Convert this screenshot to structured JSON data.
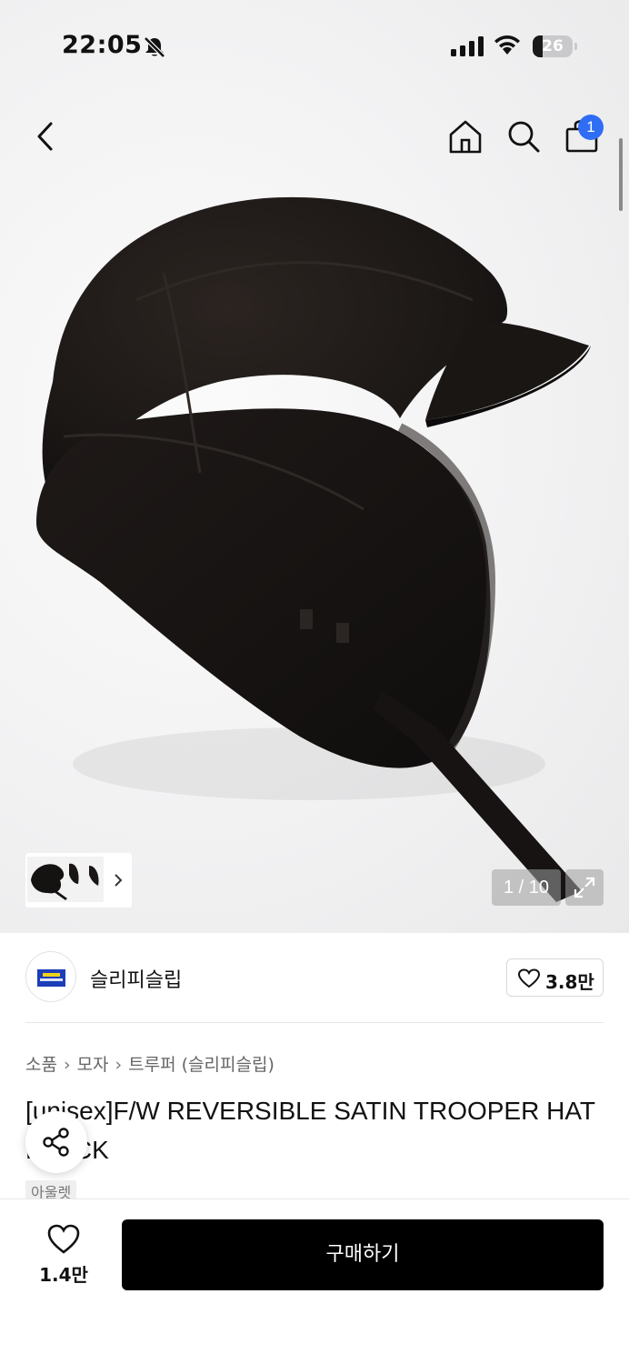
{
  "status_bar": {
    "time": "22:05",
    "battery_percent": "26",
    "battery_level": 0.26,
    "icons": [
      "bell-slash-icon",
      "cellular-signal-icon",
      "wifi-icon",
      "battery-icon"
    ]
  },
  "nav": {
    "icons": [
      "back-chevron-icon",
      "home-icon",
      "search-icon",
      "shopping-bag-icon"
    ],
    "cart_badge": "1"
  },
  "gallery": {
    "counter": "1 / 10",
    "current_index": 1,
    "total": 10,
    "icons": [
      "chevron-right-icon",
      "expand-icon"
    ]
  },
  "brand": {
    "name": "슬리피슬립",
    "like_count": "3.8만",
    "icons": [
      "heart-outline-icon"
    ]
  },
  "breadcrumb": [
    "소품",
    "모자",
    "트루퍼 (슬리피슬립)"
  ],
  "product": {
    "title": "[unisex]F/W REVERSIBLE SATIN TROOPER HAT BLACK",
    "tag": "아울렛"
  },
  "bottom_bar": {
    "wish_count": "1.4만",
    "buy_label": "구매하기",
    "icons": [
      "heart-outline-icon",
      "share-icon"
    ]
  },
  "colors": {
    "accent_badge": "#2f6df5",
    "buy_button": "#000000",
    "brand_logo_blue": "#1c3fb8",
    "brand_logo_yellow": "#f1d21a"
  }
}
